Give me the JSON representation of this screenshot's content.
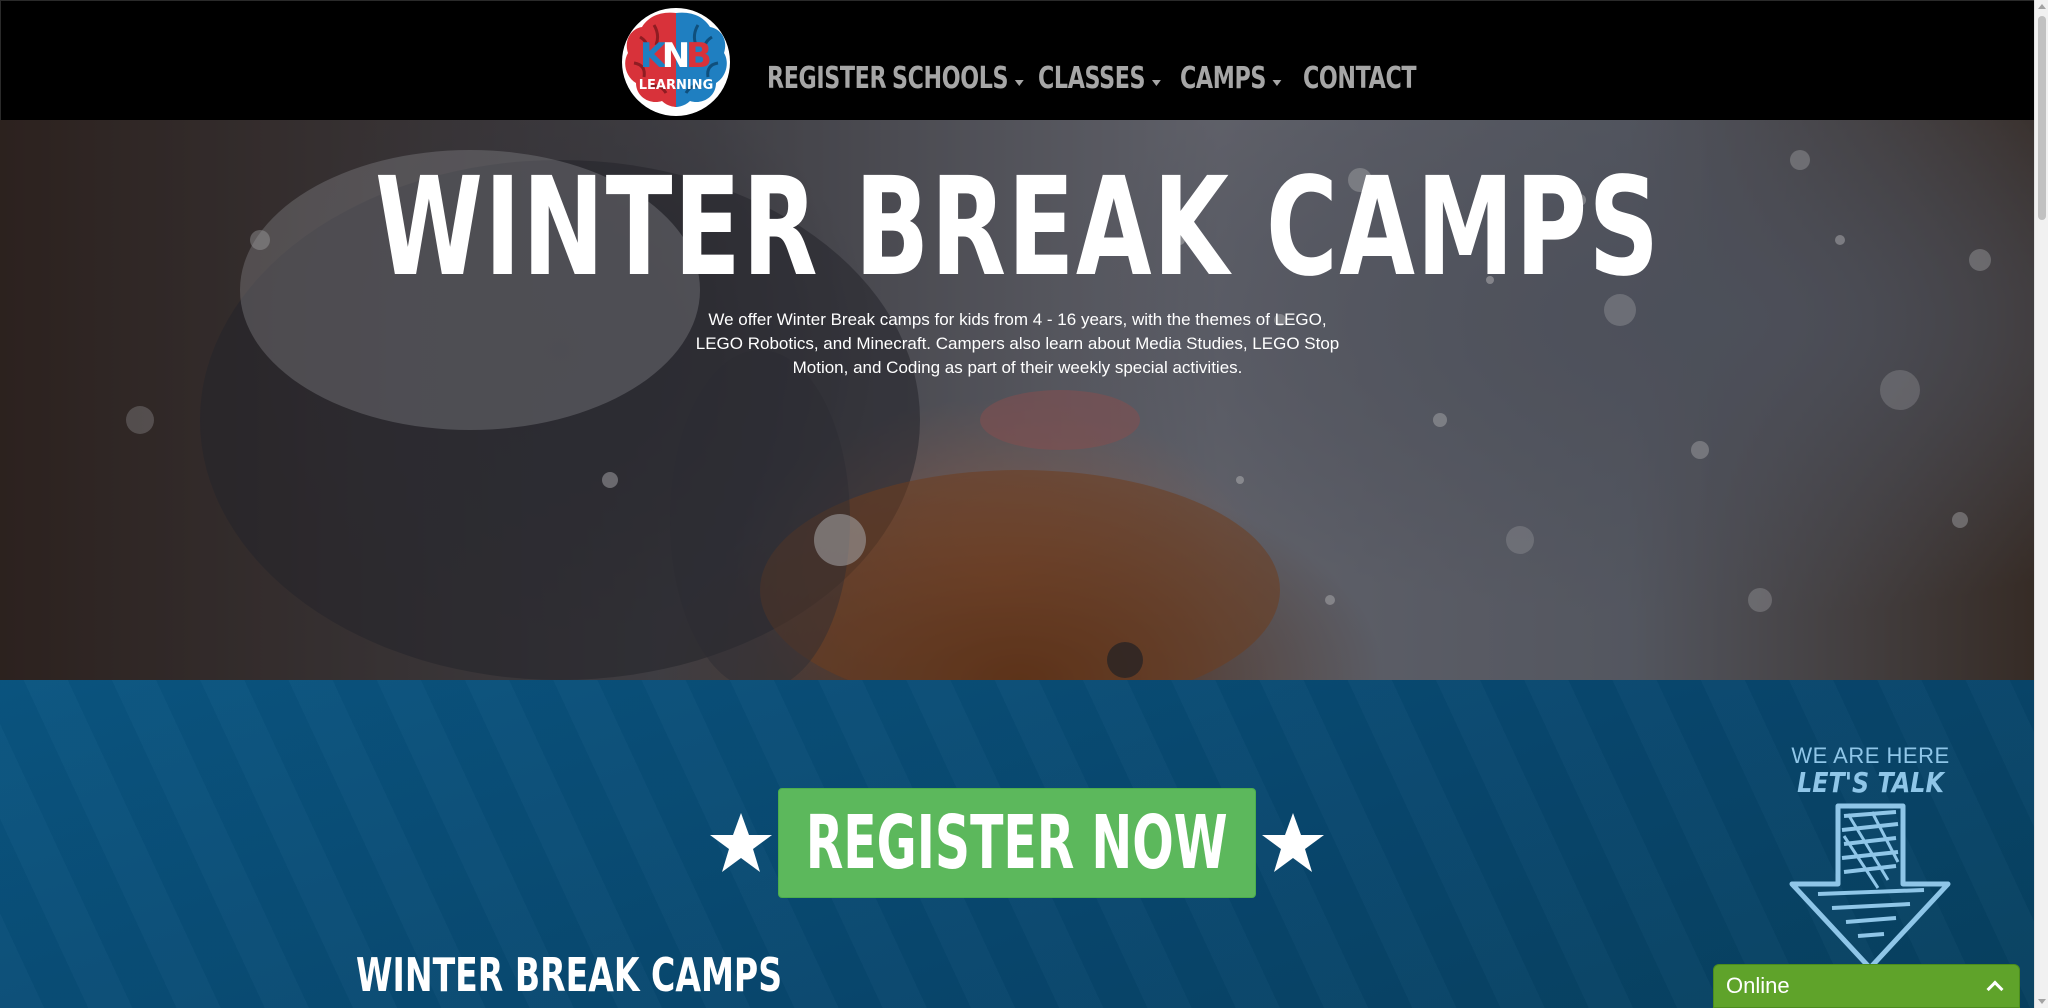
{
  "logo": {
    "letters": [
      "K",
      "N",
      "B"
    ],
    "sub": "LEARNING",
    "colors": {
      "left": "#d8323a",
      "right": "#1f7fc1",
      "ring": "#ffffff"
    }
  },
  "nav": {
    "items": [
      {
        "label": "REGISTER",
        "dropdown": false
      },
      {
        "label": "SCHOOLS",
        "dropdown": true
      },
      {
        "label": "CLASSES",
        "dropdown": true
      },
      {
        "label": "CAMPS",
        "dropdown": true
      },
      {
        "label": "CONTACT",
        "dropdown": false
      }
    ],
    "color": "#a6a6a6"
  },
  "hero": {
    "title": "WINTER BREAK CAMPS",
    "description": "We offer Winter Break camps for kids from 4 - 16 years, with the themes of LEGO, LEGO Robotics, and Minecraft. Campers also learn about Media Studies, LEGO Stop Motion, and Coding as part of their weekly special activities."
  },
  "register": {
    "label": "REGISTER NOW",
    "icon": "star-icon",
    "color": "#5cb85c"
  },
  "section": {
    "title": "WINTER BREAK CAMPS"
  },
  "talk_widget": {
    "line1": "WE ARE HERE",
    "line2": "LET'S TALK",
    "icon": "arrow-down-icon",
    "color": "#8fc6e8"
  },
  "chat": {
    "status": "Online",
    "icon": "chevron-up-icon",
    "color": "#5fa32a"
  }
}
